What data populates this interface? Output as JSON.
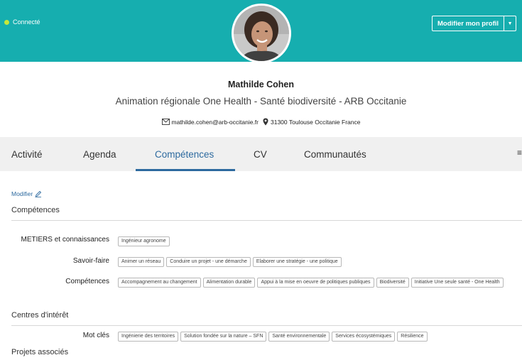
{
  "header": {
    "status_label": "Connecté",
    "edit_profile_label": "Modifier mon profil",
    "accent_color": "#16aeaf",
    "status_dot_color": "#c6e83a"
  },
  "profile": {
    "name": "Mathilde Cohen",
    "title": "Animation régionale One Health - Santé biodiversité - ARB Occitanie",
    "email": "mathilde.cohen@arb-occitanie.fr",
    "location": "31300 Toulouse Occitanie France"
  },
  "tabs": [
    {
      "label": "Activité"
    },
    {
      "label": "Agenda"
    },
    {
      "label": "Compétences"
    },
    {
      "label": "CV"
    },
    {
      "label": "Communautés"
    }
  ],
  "competences": {
    "edit_label": "Modifier",
    "section_title": "Compétences",
    "metiers_label": "METIERS et connaissances",
    "metiers_tags": [
      "Ingénieur agronome"
    ],
    "savoir_faire_label": "Savoir-faire",
    "savoir_faire_tags": [
      "Animer un réseau",
      "Conduire un projet - une démarche",
      "Elaborer une stratégie - une politique"
    ],
    "competences_label": "Compétences",
    "competences_tags": [
      "Accompagnement au changement",
      "Alimentation durable",
      "Appui à la mise en oeuvre de politiques publiques",
      "Biodiversité",
      "Initiative Une seule santé - One Health"
    ]
  },
  "interets": {
    "section_title": "Centres d'intérêt",
    "mots_cles_label": "Mot clés",
    "mots_cles_tags": [
      "Ingénierie des territoires",
      "Solution fondée sur la nature – SFN",
      "Santé environnementale",
      "Services écosystémiques",
      "Résilience"
    ]
  },
  "projets": {
    "section_title": "Projets associés"
  }
}
